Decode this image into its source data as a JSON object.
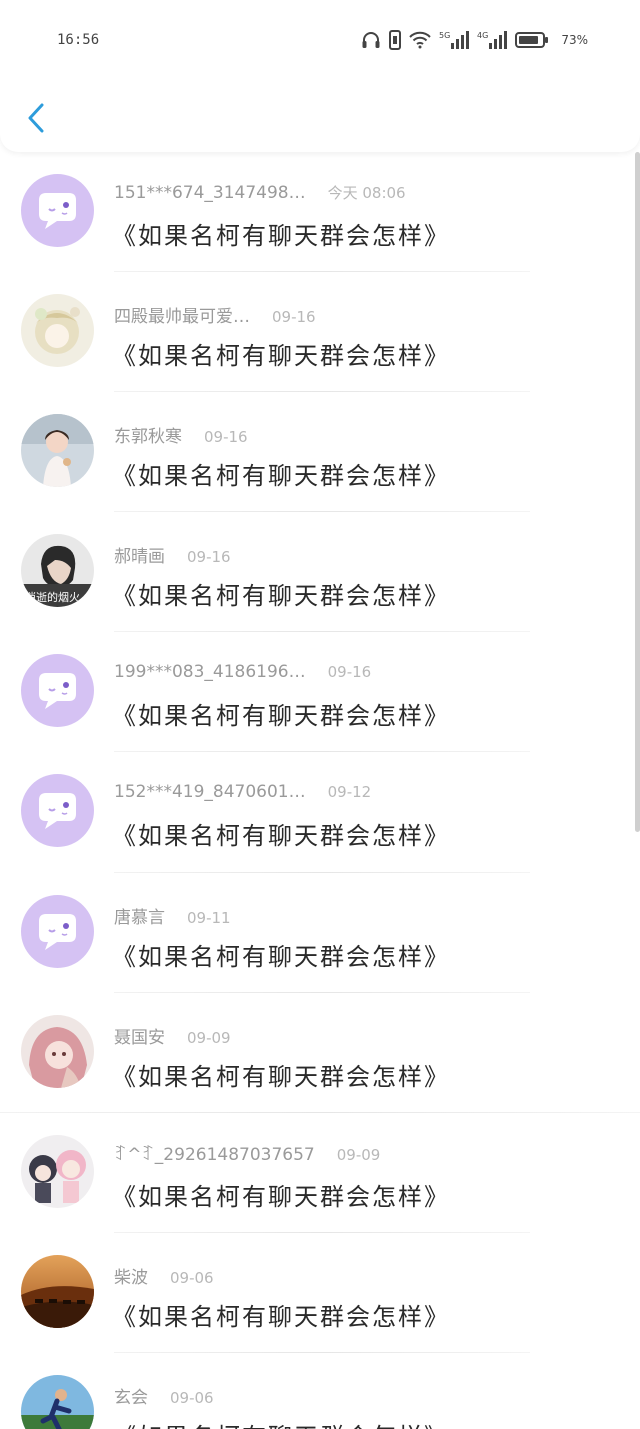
{
  "status_bar": {
    "time": "16:56",
    "network_5g": "5G",
    "network_4g": "4G",
    "battery": "73%"
  },
  "colors": {
    "accent": "#2d9cdb",
    "default_avatar_bg": "#d5c2f3"
  },
  "messages": [
    {
      "sender": "151***674_3147498…",
      "time": "今天 08:06",
      "text": "《如果名柯有聊天群会怎样》",
      "avatar": "default-chat-avatar"
    },
    {
      "sender": "四殿最帅最可爱…",
      "time": "09-16",
      "text": "《如果名柯有聊天群会怎样》",
      "avatar": "anime-girl-photo"
    },
    {
      "sender": "东郭秋寒",
      "time": "09-16",
      "text": "《如果名柯有聊天群会怎样》",
      "avatar": "child-photo"
    },
    {
      "sender": "郝晴画",
      "time": "09-16",
      "text": "《如果名柯有聊天群会怎样》",
      "avatar": "boy-photo",
      "avatar_caption": "消逝的烟火"
    },
    {
      "sender": "199***083_4186196…",
      "time": "09-16",
      "text": "《如果名柯有聊天群会怎样》",
      "avatar": "default-chat-avatar"
    },
    {
      "sender": "152***419_8470601…",
      "time": "09-12",
      "text": "《如果名柯有聊天群会怎样》",
      "avatar": "default-chat-avatar"
    },
    {
      "sender": "唐慕言",
      "time": "09-11",
      "text": "《如果名柯有聊天群会怎样》",
      "avatar": "default-chat-avatar"
    },
    {
      "sender": "聂国安",
      "time": "09-09",
      "text": "《如果名柯有聊天群会怎样》",
      "avatar": "anime-pink-hair-photo"
    },
    {
      "sender": "ꆈ^ꆈ_29261487037657",
      "time": "09-09",
      "text": "《如果名柯有聊天群会怎样》",
      "avatar": "anime-chibi-photo"
    },
    {
      "sender": "柴波",
      "time": "09-06",
      "text": "《如果名柯有聊天群会怎样》",
      "avatar": "desert-camel-photo"
    },
    {
      "sender": "玄会",
      "time": "09-06",
      "text": "《如果名柯有聊天群会怎样》",
      "avatar": "runner-photo"
    }
  ]
}
